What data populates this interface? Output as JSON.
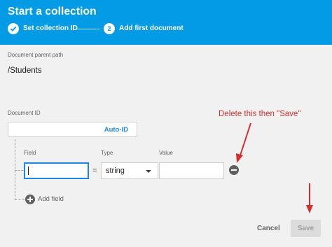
{
  "header": {
    "title": "Start a collection",
    "step1_label": "Set collection ID",
    "step2_number": "2",
    "step2_label": "Add first document",
    "color": "#039be5"
  },
  "document": {
    "parent_path_label": "Document parent path",
    "parent_path_value": "/Students",
    "id_label": "Document ID",
    "auto_id_label": "Auto-ID"
  },
  "fields": {
    "field_label": "Field",
    "type_label": "Type",
    "value_label": "Value",
    "equals": "=",
    "row": {
      "field_value": "",
      "type_value": "string",
      "value_value": ""
    },
    "add_field_label": "Add field"
  },
  "annotation": {
    "text": "Delete this then \"Save\"",
    "color": "#d32f2f"
  },
  "footer": {
    "cancel_label": "Cancel",
    "save_label": "Save"
  },
  "icons": {
    "step1": "check-icon",
    "remove": "remove-circle-icon",
    "add": "add-circle-icon",
    "dropdown": "chevron-down-icon"
  }
}
